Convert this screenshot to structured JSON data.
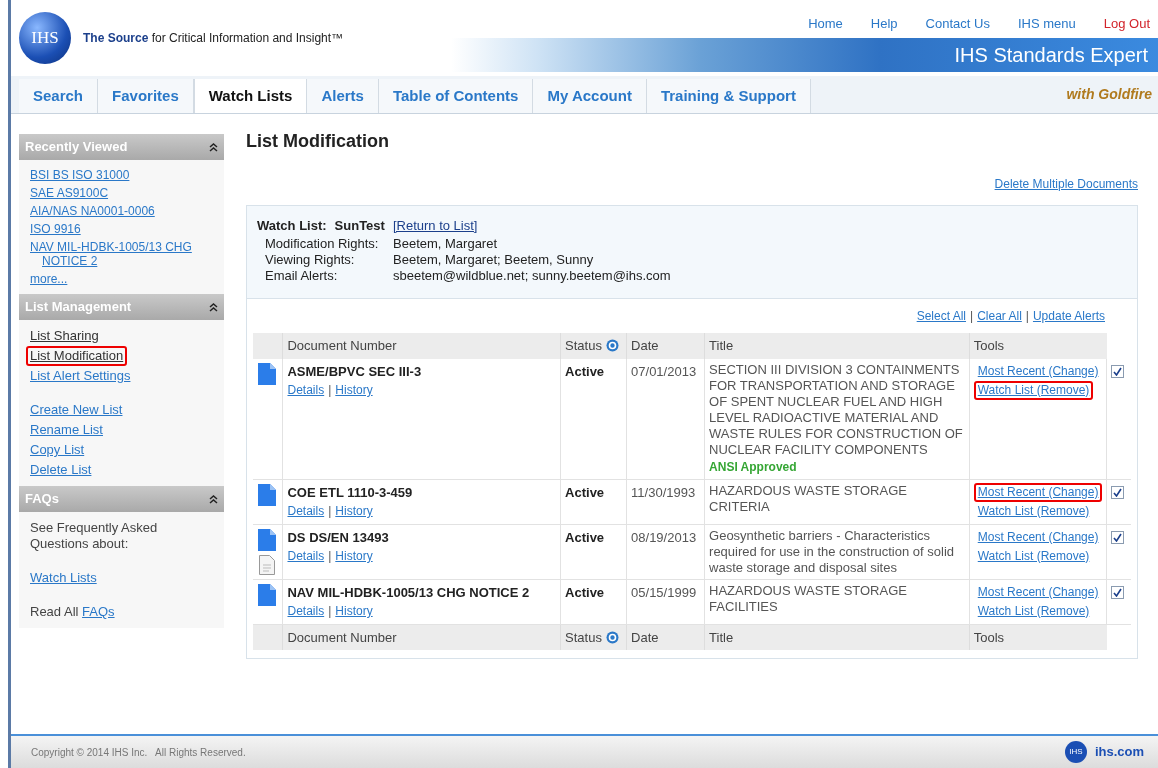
{
  "header": {
    "logo": "IHS",
    "tagline": "**The Source** for Critical Information and Insight™",
    "top_links": [
      {
        "label": "Home",
        "kind": "normal"
      },
      {
        "label": "Help",
        "kind": "normal"
      },
      {
        "label": "Contact Us",
        "kind": "normal"
      },
      {
        "label": "IHS menu",
        "kind": "normal"
      },
      {
        "label": "Log Out",
        "kind": "logout"
      }
    ],
    "product": "IHS Standards Expert",
    "edition": "with Goldfire"
  },
  "tabs": [
    {
      "label": "Search",
      "selected": false
    },
    {
      "label": "Favorites",
      "selected": false
    },
    {
      "label": "Watch Lists",
      "selected": true
    },
    {
      "label": "Alerts",
      "selected": false
    },
    {
      "label": "Table of Contents",
      "selected": false
    },
    {
      "label": "My Account",
      "selected": false
    },
    {
      "label": "Training & Support",
      "selected": false
    }
  ],
  "sidebar": {
    "sections": [
      {
        "title": "Recently Viewed",
        "items": [
          {
            "label": "BSI BS ISO 31000",
            "kind": "link",
            "highlighted": false
          },
          {
            "label": "SAE AS9100C",
            "kind": "link",
            "highlighted": false
          },
          {
            "label": "AIA/NAS NA0001-0006",
            "kind": "link",
            "highlighted": false
          },
          {
            "label": "ISO 9916",
            "kind": "link",
            "highlighted": false
          },
          {
            "label": "NAV MIL-HDBK-1005/13 CHG NOTICE 2",
            "kind": "link",
            "highlighted": false
          },
          {
            "label": "more...",
            "kind": "link",
            "highlighted": false
          }
        ]
      },
      {
        "title": "List Management",
        "items": [
          {
            "label": "List Sharing",
            "kind": "nav",
            "highlighted": false
          },
          {
            "label": "List Modification",
            "kind": "nav",
            "highlighted": true
          },
          {
            "label": "List Alert Settings",
            "kind": "link",
            "highlighted": false
          },
          {
            "label": "Create New List",
            "kind": "link-gap",
            "highlighted": false
          },
          {
            "label": "Rename List",
            "kind": "link",
            "highlighted": false
          },
          {
            "label": "Copy List",
            "kind": "link",
            "highlighted": false
          },
          {
            "label": "Delete List",
            "kind": "link",
            "highlighted": false
          }
        ]
      },
      {
        "title": "FAQs",
        "items": [
          {
            "label": "See Frequently Asked Questions about:",
            "kind": "text",
            "highlighted": false
          },
          {
            "label": "Watch Lists",
            "kind": "link-gap",
            "highlighted": false
          },
          {
            "label": "Read All",
            "kind": "text-gap",
            "highlighted": false,
            "link": "FAQs"
          }
        ]
      }
    ]
  },
  "main": {
    "title": "List Modification",
    "delete_link": "Delete Multiple Documents",
    "watch_list": {
      "label": "Watch List:",
      "name": "SunTest",
      "return_link": "[Return to List]",
      "fields": [
        {
          "label": "Modification Rights:",
          "value": "Beetem, Margaret"
        },
        {
          "label": "Viewing Rights:",
          "value": "Beetem, Margaret; Beetem, Sunny"
        },
        {
          "label": "Email Alerts:",
          "value": "sbeetem@wildblue.net; sunny.beetem@ihs.com"
        }
      ]
    },
    "actions": [
      {
        "kind": "link",
        "label": "Select All"
      },
      {
        "kind": "separator",
        "label": "|"
      },
      {
        "kind": "link",
        "label": "Clear All"
      },
      {
        "kind": "separator",
        "label": "|"
      },
      {
        "kind": "link",
        "label": "Update Alerts"
      }
    ],
    "table": {
      "columns": [
        "Document Number",
        "Status",
        "Date",
        "Title",
        "Tools"
      ],
      "rows": [
        {
          "number": "ASME/BPVC SEC III-3",
          "links": [
            {
              "kind": "link",
              "label": "Details"
            },
            {
              "kind": "separator",
              "label": "|"
            },
            {
              "kind": "link",
              "label": "History"
            }
          ],
          "attachment": false,
          "status": "Active",
          "date": "07/01/2013",
          "title": "SECTION III DIVISION 3 CONTAINMENTS FOR TRANSPORTATION AND STORAGE OF SPENT NUCLEAR FUEL AND HIGH LEVEL RADIOACTIVE MATERIAL AND WASTE RULES FOR CONSTRUCTION OF NUCLEAR FACILITY COMPONENTS",
          "badge": "ANSI Approved",
          "tools": [
            {
              "label": "Most Recent (Change)",
              "highlighted": false
            },
            {
              "label": "Watch List (Remove)",
              "highlighted": true
            }
          ],
          "checked": true
        },
        {
          "number": "COE ETL 1110-3-459",
          "links": [
            {
              "kind": "link",
              "label": "Details"
            },
            {
              "kind": "separator",
              "label": "|"
            },
            {
              "kind": "link",
              "label": "History"
            }
          ],
          "attachment": false,
          "status": "Active",
          "date": "11/30/1993",
          "title": "HAZARDOUS WASTE STORAGE CRITERIA",
          "tools": [
            {
              "label": "Most Recent (Change)",
              "highlighted": true
            },
            {
              "label": "Watch List (Remove)",
              "highlighted": false
            }
          ],
          "checked": true
        },
        {
          "number": "DS DS/EN 13493",
          "links": [
            {
              "kind": "link",
              "label": "Details"
            },
            {
              "kind": "separator",
              "label": "|"
            },
            {
              "kind": "link",
              "label": "History"
            }
          ],
          "attachment": true,
          "status": "Active",
          "date": "08/19/2013",
          "title": "Geosynthetic barriers - Characteristics required for use in the construction of solid waste storage and disposal sites",
          "tools": [
            {
              "label": "Most Recent (Change)",
              "highlighted": false
            },
            {
              "label": "Watch List (Remove)",
              "highlighted": false
            }
          ],
          "checked": true
        },
        {
          "number": "NAV MIL-HDBK-1005/13 CHG NOTICE 2",
          "links": [
            {
              "kind": "link",
              "label": "Details"
            },
            {
              "kind": "separator",
              "label": "|"
            },
            {
              "kind": "link",
              "label": "History"
            }
          ],
          "attachment": false,
          "status": "Active",
          "date": "05/15/1999",
          "title": "HAZARDOUS WASTE STORAGE FACILITIES",
          "tools": [
            {
              "label": "Most Recent (Change)",
              "highlighted": false
            },
            {
              "label": "Watch List (Remove)",
              "highlighted": false
            }
          ],
          "checked": true
        }
      ],
      "footer_columns": [
        "Document Number",
        "Status",
        "Date",
        "Title",
        "Tools"
      ]
    }
  },
  "footer": {
    "copyright": "Copyright © 2014 IHS Inc.   All Rights Reserved.",
    "logo": "IHS",
    "site": "ihs.com"
  }
}
